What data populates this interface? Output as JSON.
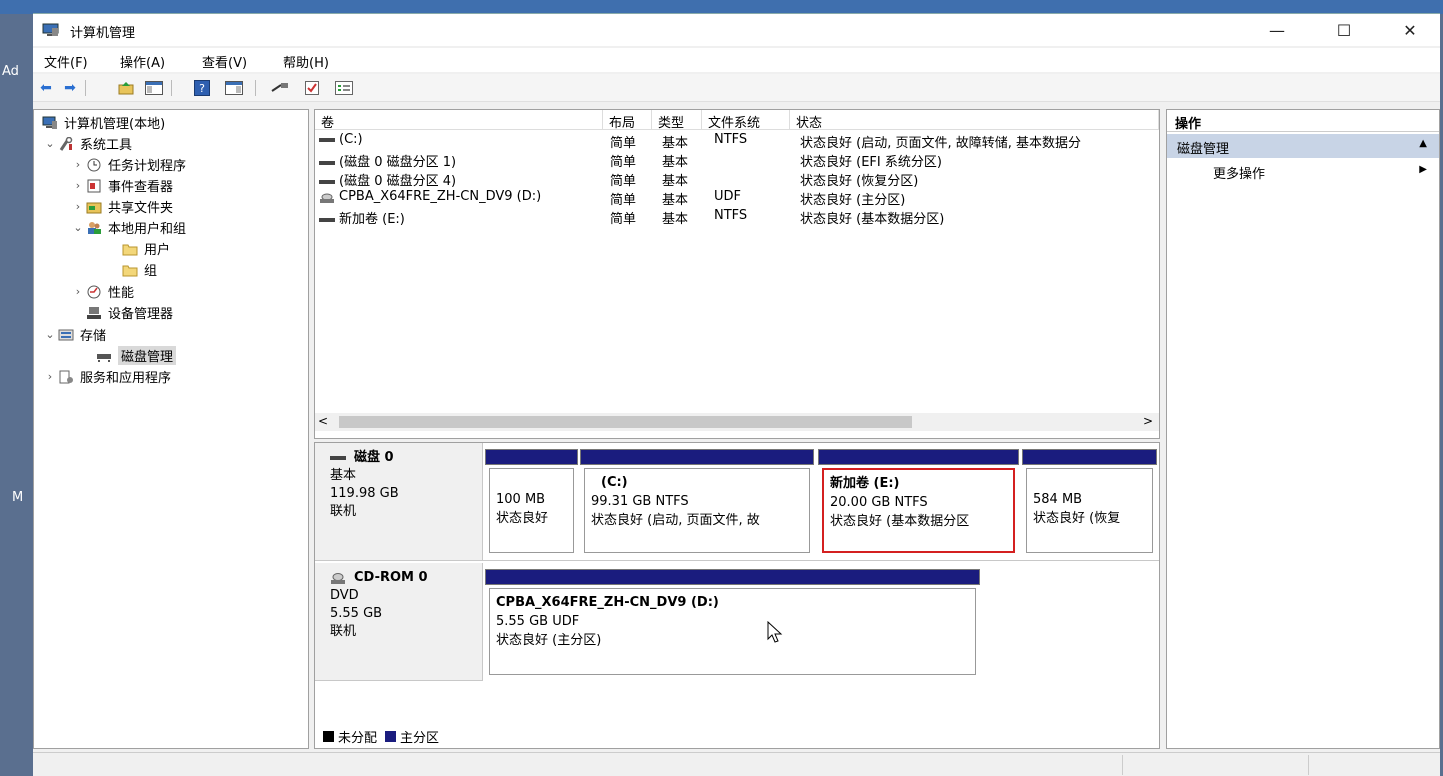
{
  "desktop": {
    "text_1": "Ad",
    "text_2": "M"
  },
  "window": {
    "title": "计算机管理",
    "controls": {
      "minimize": "—",
      "maximize": "☐",
      "close": "✕"
    }
  },
  "menu": [
    "文件(F)",
    "操作(A)",
    "查看(V)",
    "帮助(H)"
  ],
  "tree": {
    "root": "计算机管理(本地)",
    "system_tools": "系统工具",
    "task_scheduler": "任务计划程序",
    "event_viewer": "事件查看器",
    "shared_folders": "共享文件夹",
    "local_users": "本地用户和组",
    "users": "用户",
    "groups": "组",
    "performance": "性能",
    "device_manager": "设备管理器",
    "storage": "存储",
    "disk_management": "磁盘管理",
    "services_apps": "服务和应用程序"
  },
  "volume_list": {
    "columns": [
      "卷",
      "布局",
      "类型",
      "文件系统",
      "状态"
    ],
    "rows": [
      {
        "name": "(C:)",
        "layout": "简单",
        "type": "基本",
        "fs": "NTFS",
        "status": "状态良好 (启动, 页面文件, 故障转储, 基本数据分"
      },
      {
        "name": "(磁盘 0 磁盘分区 1)",
        "layout": "简单",
        "type": "基本",
        "fs": "",
        "status": "状态良好 (EFI 系统分区)"
      },
      {
        "name": "(磁盘 0 磁盘分区 4)",
        "layout": "简单",
        "type": "基本",
        "fs": "",
        "status": "状态良好 (恢复分区)"
      },
      {
        "name": "CPBA_X64FRE_ZH-CN_DV9 (D:)",
        "layout": "简单",
        "type": "基本",
        "fs": "UDF",
        "status": "状态良好 (主分区)"
      },
      {
        "name": "新加卷 (E:)",
        "layout": "简单",
        "type": "基本",
        "fs": "NTFS",
        "status": "状态良好 (基本数据分区)"
      }
    ],
    "scroll_left": "<",
    "scroll_right": ">"
  },
  "disk0": {
    "name": "磁盘 0",
    "type": "基本",
    "size": "119.98 GB",
    "status": "联机",
    "partitions": [
      {
        "title": "",
        "size": "100 MB",
        "status": "状态良好"
      },
      {
        "title": "(C:)",
        "size": "99.31 GB NTFS",
        "status": "状态良好 (启动, 页面文件, 故"
      },
      {
        "title": "新加卷  (E:)",
        "size": "20.00 GB NTFS",
        "status": "状态良好 (基本数据分区"
      },
      {
        "title": "",
        "size": "584 MB",
        "status": "状态良好 (恢复"
      }
    ]
  },
  "cdrom0": {
    "name": "CD-ROM 0",
    "type": "DVD",
    "size": "5.55 GB",
    "status": "联机",
    "partition": {
      "title": "CPBA_X64FRE_ZH-CN_DV9  (D:)",
      "size": "5.55 GB UDF",
      "status": "状态良好 (主分区)"
    }
  },
  "legend": {
    "unallocated": "未分配",
    "primary": "主分区"
  },
  "actions": {
    "header": "操作",
    "section": "磁盘管理",
    "more": "更多操作",
    "collapse_glyph": "▲",
    "more_glyph": "▶"
  },
  "colors": {
    "partition_bar": "#1a1c7e",
    "selection_outline": "#d42020",
    "actions_highlight": "#c8d4e6"
  }
}
